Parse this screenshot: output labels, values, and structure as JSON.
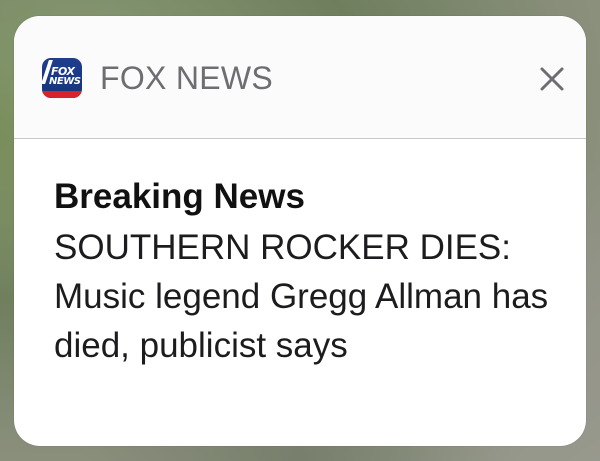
{
  "notification": {
    "app": {
      "name": "FOX NEWS",
      "icon": "fox-news-logo-icon",
      "icon_text_top": "FOX",
      "icon_text_bottom": "NEWS",
      "icon_colors": {
        "blue": "#1e3e8c",
        "red": "#d8232a"
      }
    },
    "close_icon": "close-icon",
    "title": "Breaking News",
    "message": "SOUTHERN ROCKER DIES: Music legend Gregg Allman has died, publicist says"
  }
}
